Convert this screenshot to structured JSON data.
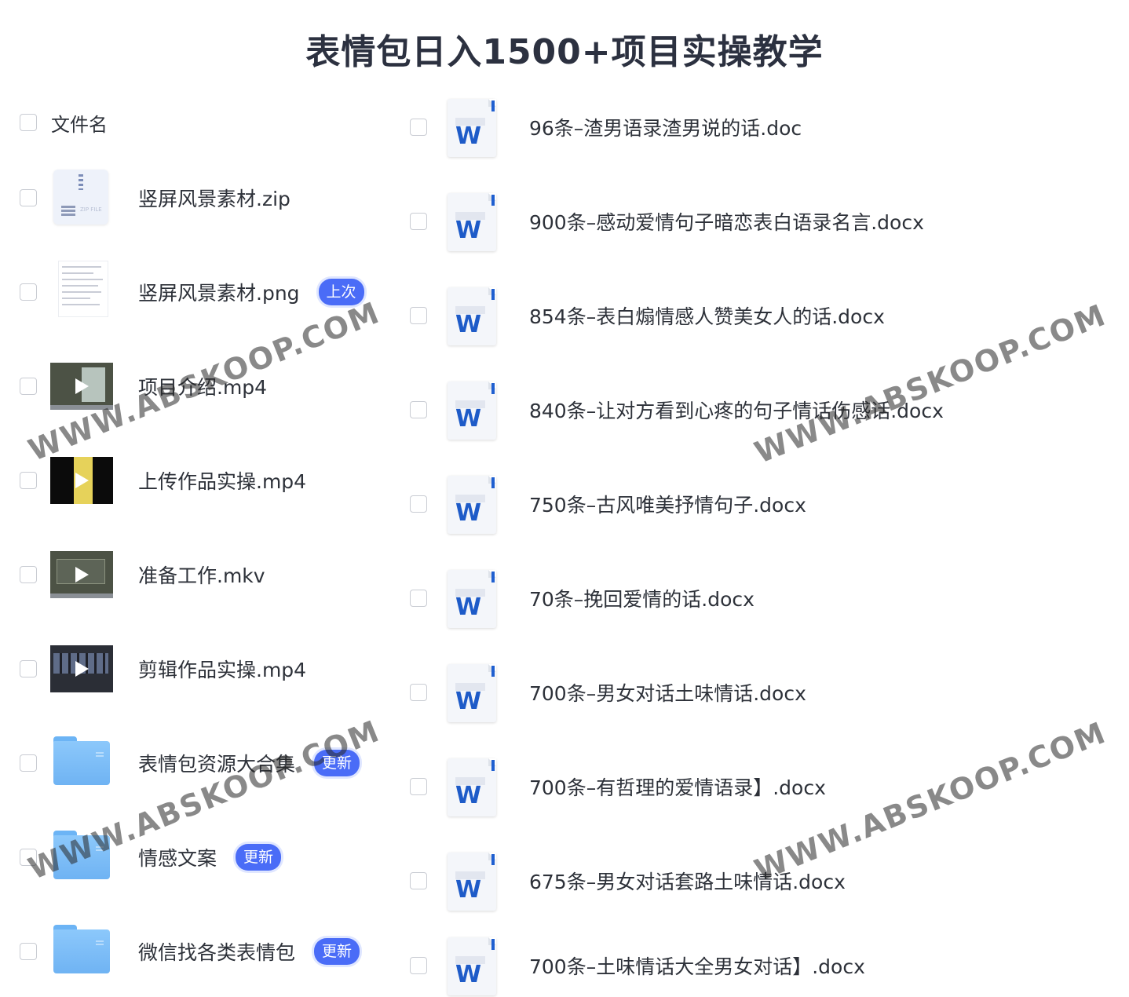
{
  "title": "表情包日入1500+项目实操教学",
  "header_label": "文件名",
  "watermark": "WWW.ABSKOOP.COM",
  "left_files": [
    {
      "name": "竖屏风景素材.zip",
      "icon": "zip-icon",
      "badge": ""
    },
    {
      "name": "竖屏风景素材.png",
      "icon": "image-icon",
      "badge": "上次"
    },
    {
      "name": "项目介绍.mp4",
      "icon": "video-icon",
      "badge": ""
    },
    {
      "name": "上传作品实操.mp4",
      "icon": "video-icon",
      "badge": ""
    },
    {
      "name": "准备工作.mkv",
      "icon": "video-icon",
      "badge": ""
    },
    {
      "name": "剪辑作品实操.mp4",
      "icon": "video-icon",
      "badge": ""
    },
    {
      "name": "表情包资源大合集",
      "icon": "folder-icon",
      "badge": "更新"
    },
    {
      "name": "情感文案",
      "icon": "folder-icon",
      "badge": "更新"
    },
    {
      "name": "微信找各类表情包",
      "icon": "folder-icon",
      "badge": "更新"
    }
  ],
  "right_files": [
    {
      "name": "96条–渣男语录渣男说的话.doc",
      "icon": "word-icon"
    },
    {
      "name": "900条–感动爱情句子暗恋表白语录名言.docx",
      "icon": "word-icon"
    },
    {
      "name": "854条–表白煽情感人赞美女人的话.docx",
      "icon": "word-icon"
    },
    {
      "name": "840条–让对方看到心疼的句子情话伤感话.docx",
      "icon": "word-icon"
    },
    {
      "name": "750条–古风唯美抒情句子.docx",
      "icon": "word-icon"
    },
    {
      "name": "70条–挽回爱情的话.docx",
      "icon": "word-icon"
    },
    {
      "name": "700条–男女对话土味情话.docx",
      "icon": "word-icon"
    },
    {
      "name": "700条–有哲理的爱情语录】.docx",
      "icon": "word-icon"
    },
    {
      "name": "675条–男女对话套路土味情话.docx",
      "icon": "word-icon"
    },
    {
      "name": "700条–土味情话大全男女对话】.docx",
      "icon": "word-icon"
    }
  ],
  "word_letter": "W",
  "colors": {
    "badge": "#4a6cf7",
    "folder": "#7ab9f6",
    "word": "#1e5bc8"
  }
}
